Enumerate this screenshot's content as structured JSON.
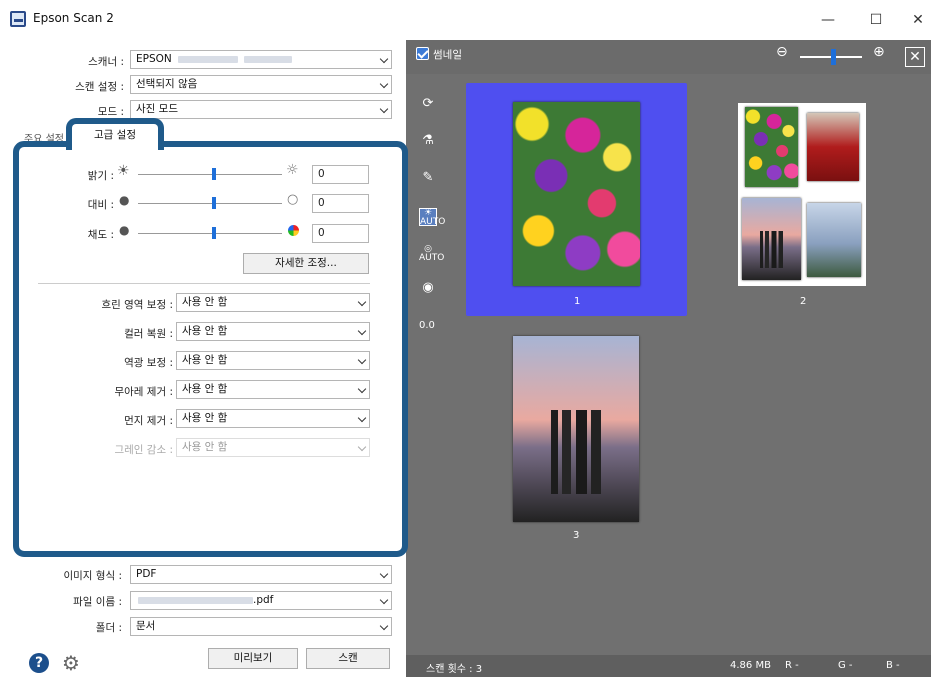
{
  "window": {
    "title": "Epson Scan 2",
    "minimize": "—",
    "maximize": "☐",
    "close": "✕"
  },
  "top": {
    "scanner_label": "스캐너 :",
    "scanner_value": "EPSON",
    "scan_setting_label": "스캔 설정 :",
    "scan_setting_value": "선택되지 않음",
    "mode_label": "모드 :",
    "mode_value": "사진 모드"
  },
  "tabs": {
    "main_label": "주요 설정",
    "advanced_label": "고급 설정"
  },
  "adjust": {
    "brightness_label": "밝기 :",
    "brightness_value": "0",
    "contrast_label": "대비 :",
    "contrast_value": "0",
    "saturation_label": "채도 :",
    "saturation_value": "0",
    "detail_button": "자세한 조정..."
  },
  "options": [
    {
      "label": "흐린 영역 보정 :",
      "value": "사용 안 함"
    },
    {
      "label": "컬러 복원 :",
      "value": "사용 안 함"
    },
    {
      "label": "역광 보정 :",
      "value": "사용 안 함"
    },
    {
      "label": "무아레 제거 :",
      "value": "사용 안 함"
    },
    {
      "label": "먼지 제거 :",
      "value": "사용 안 함"
    },
    {
      "label": "그레인 감소 :",
      "value": "사용 안 함"
    }
  ],
  "bottom": {
    "image_format_label": "이미지 형식 :",
    "image_format_value": "PDF",
    "filename_label": "파일 이름 :",
    "filename_ext": ".pdf",
    "folder_label": "폴더 :",
    "folder_value": "문서",
    "preview_button": "미리보기",
    "scan_button": "스캔"
  },
  "preview": {
    "thumbnail_label": "썸네일",
    "zoom_out": "⊖",
    "zoom_in": "⊕",
    "close": "✕",
    "tool_value": "0.0",
    "thumbnails": [
      {
        "num": "1"
      },
      {
        "num": "2"
      },
      {
        "num": "3"
      }
    ]
  },
  "status": {
    "scan_count": "스캔 횟수 : 3",
    "size": "4.86 MB",
    "r": "R  -",
    "g": "G  -",
    "b": "B  -"
  }
}
